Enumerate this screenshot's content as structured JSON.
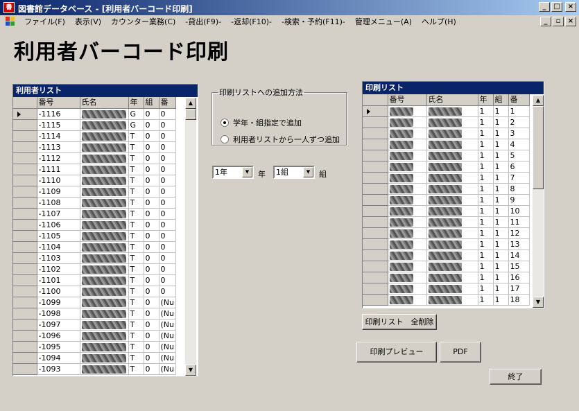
{
  "window": {
    "title": "図書館データベース - [利用者バーコード印刷]",
    "icon": "app-icon",
    "buttons": [
      "_",
      "□",
      "×"
    ],
    "mdi_buttons": [
      "_",
      "▫",
      "×"
    ]
  },
  "menu": [
    "ファイル(F)",
    "表示(V)",
    "カウンター業務(C)",
    "-貸出(F9)-",
    "-返却(F10)-",
    "-検索・予約(F11)-",
    "管理メニュー(A)",
    "ヘルプ(H)"
  ],
  "page_title": "利用者バーコード印刷",
  "user_list": {
    "caption": "利用者リスト",
    "columns": [
      "番号",
      "氏名",
      "年",
      "組",
      "番"
    ],
    "rows": [
      {
        "no": "-1116",
        "year": "G",
        "class": "0",
        "num": "0"
      },
      {
        "no": "-1115",
        "year": "G",
        "class": "0",
        "num": "0"
      },
      {
        "no": "-1114",
        "year": "T",
        "class": "0",
        "num": "0"
      },
      {
        "no": "-1113",
        "year": "T",
        "class": "0",
        "num": "0"
      },
      {
        "no": "-1112",
        "year": "T",
        "class": "0",
        "num": "0"
      },
      {
        "no": "-1111",
        "year": "T",
        "class": "0",
        "num": "0"
      },
      {
        "no": "-1110",
        "year": "T",
        "class": "0",
        "num": "0"
      },
      {
        "no": "-1109",
        "year": "T",
        "class": "0",
        "num": "0"
      },
      {
        "no": "-1108",
        "year": "T",
        "class": "0",
        "num": "0"
      },
      {
        "no": "-1107",
        "year": "T",
        "class": "0",
        "num": "0"
      },
      {
        "no": "-1106",
        "year": "T",
        "class": "0",
        "num": "0"
      },
      {
        "no": "-1105",
        "year": "T",
        "class": "0",
        "num": "0"
      },
      {
        "no": "-1104",
        "year": "T",
        "class": "0",
        "num": "0"
      },
      {
        "no": "-1103",
        "year": "T",
        "class": "0",
        "num": "0"
      },
      {
        "no": "-1102",
        "year": "T",
        "class": "0",
        "num": "0"
      },
      {
        "no": "-1101",
        "year": "T",
        "class": "0",
        "num": "0"
      },
      {
        "no": "-1100",
        "year": "T",
        "class": "0",
        "num": "0"
      },
      {
        "no": "-1099",
        "year": "T",
        "class": "0",
        "num": "(Nu"
      },
      {
        "no": "-1098",
        "year": "T",
        "class": "0",
        "num": "(Nu"
      },
      {
        "no": "-1097",
        "year": "T",
        "class": "0",
        "num": "(Nu"
      },
      {
        "no": "-1096",
        "year": "T",
        "class": "0",
        "num": "(Nu"
      },
      {
        "no": "-1095",
        "year": "T",
        "class": "0",
        "num": "(Nu"
      },
      {
        "no": "-1094",
        "year": "T",
        "class": "0",
        "num": "(Nu"
      },
      {
        "no": "-1093",
        "year": "T",
        "class": "0",
        "num": "(Nu"
      }
    ]
  },
  "add_method": {
    "legend": "印刷リストへの追加方法",
    "option1": "学年・組指定で追加",
    "option2": "利用者リストから一人ずつ追加",
    "selected": 1
  },
  "grade_select": {
    "value": "1年",
    "label": "年"
  },
  "class_select": {
    "value": "1組",
    "label": "組"
  },
  "print_list": {
    "caption": "印刷リスト",
    "columns": [
      "番号",
      "氏名",
      "年",
      "組",
      "番"
    ],
    "rows": [
      {
        "year": "1",
        "class": "1",
        "num": "1"
      },
      {
        "year": "1",
        "class": "1",
        "num": "2"
      },
      {
        "year": "1",
        "class": "1",
        "num": "3"
      },
      {
        "year": "1",
        "class": "1",
        "num": "4"
      },
      {
        "year": "1",
        "class": "1",
        "num": "5"
      },
      {
        "year": "1",
        "class": "1",
        "num": "6"
      },
      {
        "year": "1",
        "class": "1",
        "num": "7"
      },
      {
        "year": "1",
        "class": "1",
        "num": "8"
      },
      {
        "year": "1",
        "class": "1",
        "num": "9"
      },
      {
        "year": "1",
        "class": "1",
        "num": "10"
      },
      {
        "year": "1",
        "class": "1",
        "num": "11"
      },
      {
        "year": "1",
        "class": "1",
        "num": "12"
      },
      {
        "year": "1",
        "class": "1",
        "num": "13"
      },
      {
        "year": "1",
        "class": "1",
        "num": "14"
      },
      {
        "year": "1",
        "class": "1",
        "num": "15"
      },
      {
        "year": "1",
        "class": "1",
        "num": "16"
      },
      {
        "year": "1",
        "class": "1",
        "num": "17"
      },
      {
        "year": "1",
        "class": "1",
        "num": "18"
      }
    ]
  },
  "buttons": {
    "clear_all": "印刷リスト　全削除",
    "preview": "印刷プレビュー",
    "pdf": "PDF",
    "exit": "終了"
  }
}
